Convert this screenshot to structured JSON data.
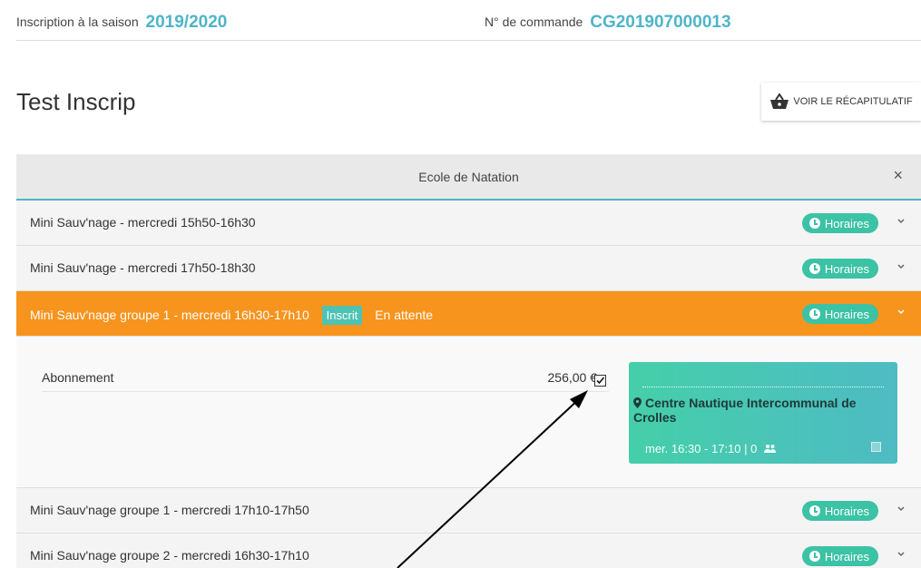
{
  "header": {
    "season_prefix": "Inscription à la saison",
    "season_value": "2019/2020",
    "order_prefix": "N° de commande",
    "order_value": "CG201907000013"
  },
  "page": {
    "title": "Test Inscrip",
    "recap_button": "VOIR LE RÉCAPITULATIF"
  },
  "panel": {
    "title": "Ecole de Natation",
    "close": "×",
    "horaires_label": "Horaires",
    "rows": [
      {
        "label": "Mini Sauv'nage - mercredi 15h50-16h30"
      },
      {
        "label": "Mini Sauv'nage - mercredi 17h50-18h30"
      },
      {
        "label": "Mini Sauv'nage groupe 1 - mercredi 16h30-17h10",
        "badge": "Inscrit",
        "status": "En attente"
      },
      {
        "label": "Mini Sauv'nage groupe 1 - mercredi 17h10-17h50"
      },
      {
        "label": "Mini Sauv'nage groupe 2 - mercredi 16h30-17h10"
      }
    ],
    "detail": {
      "item_name": "Abonnement",
      "item_price": "256,00 €",
      "venue": "Centre Nautique Intercommunal de Crolles",
      "slot": "mer. 16:30 - 17:10 | 0"
    }
  },
  "colors": {
    "accent_teal": "#4eb5c7",
    "active_orange": "#f7941d",
    "horaires_green": "#3cc2a4"
  }
}
